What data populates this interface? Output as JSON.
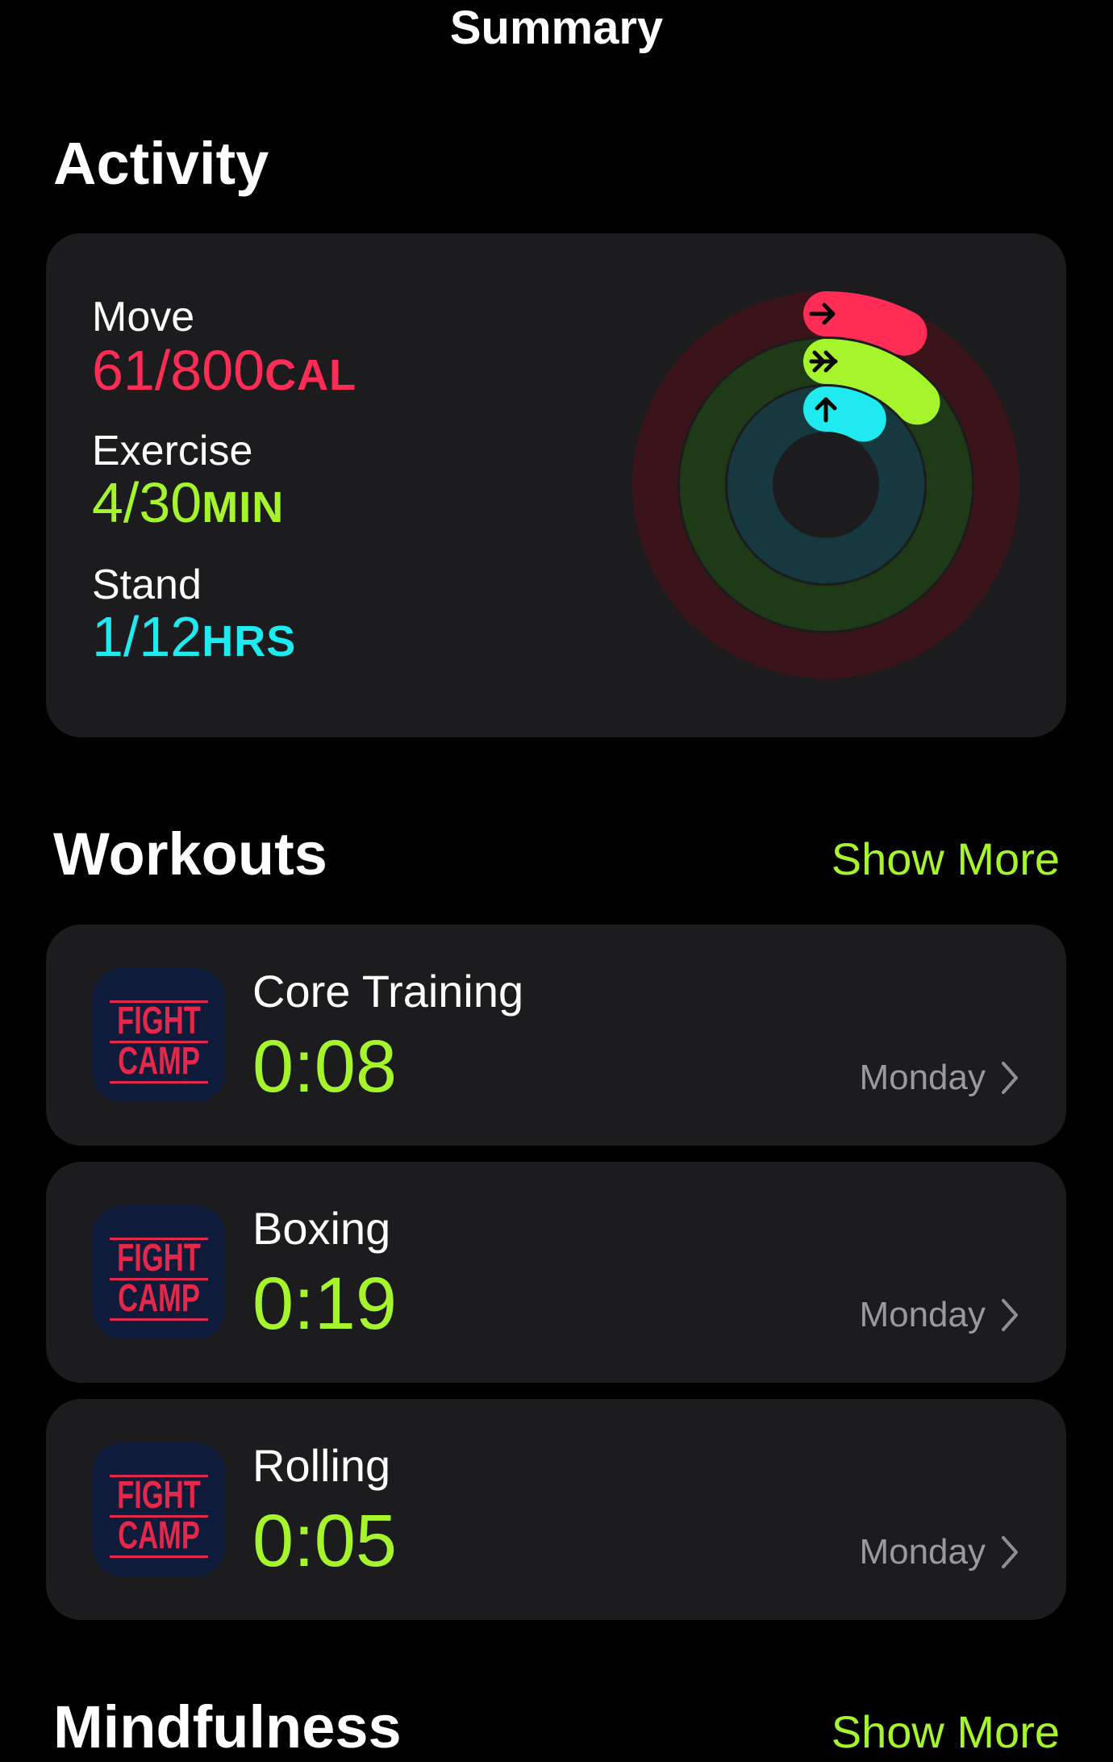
{
  "nav": {
    "title": "Summary"
  },
  "activity": {
    "title": "Activity",
    "move": {
      "label": "Move",
      "value": "61/800",
      "unit": "CAL",
      "color": "#FF2D55",
      "progress": 0.076
    },
    "exercise": {
      "label": "Exercise",
      "value": "4/30",
      "unit": "MIN",
      "color": "#A6F52C",
      "progress": 0.133
    },
    "stand": {
      "label": "Stand",
      "value": "1/12",
      "unit": "HRS",
      "color": "#1EEAF0",
      "progress": 0.083
    },
    "ring_icons": [
      "arrow-right-icon",
      "double-arrow-right-icon",
      "arrow-up-icon"
    ]
  },
  "workouts": {
    "title": "Workouts",
    "show_more": "Show More",
    "items": [
      {
        "app_icon_text": [
          "FIGHT",
          "CAMP"
        ],
        "name": "Core Training",
        "time": "0:08",
        "day": "Monday"
      },
      {
        "app_icon_text": [
          "FIGHT",
          "CAMP"
        ],
        "name": "Boxing",
        "time": "0:19",
        "day": "Monday"
      },
      {
        "app_icon_text": [
          "FIGHT",
          "CAMP"
        ],
        "name": "Rolling",
        "time": "0:05",
        "day": "Monday"
      }
    ]
  },
  "mindfulness": {
    "title": "Mindfulness",
    "show_more": "Show More"
  }
}
